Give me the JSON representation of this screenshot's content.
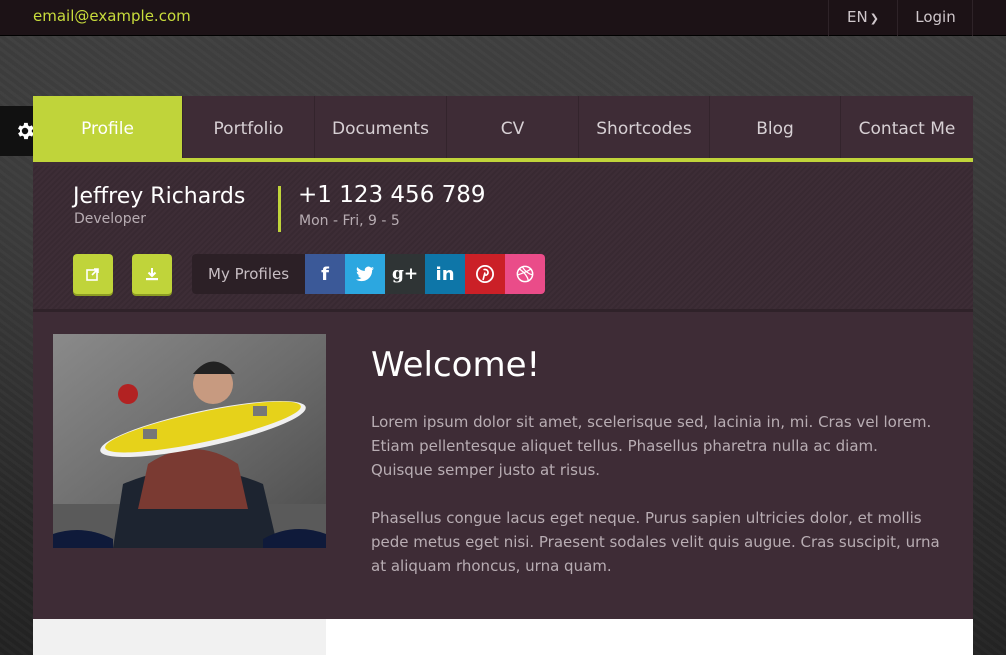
{
  "topbar": {
    "email": "email@example.com",
    "language": "EN",
    "login": "Login"
  },
  "settings": {
    "icon": "gear-icon"
  },
  "nav": {
    "tabs": [
      {
        "label": "Profile",
        "active": true
      },
      {
        "label": "Portfolio",
        "active": false
      },
      {
        "label": "Documents",
        "active": false
      },
      {
        "label": "CV",
        "active": false
      },
      {
        "label": "Shortcodes",
        "active": false
      },
      {
        "label": "Blog",
        "active": false
      },
      {
        "label": "Contact Me",
        "active": false
      }
    ]
  },
  "profile": {
    "name": "Jeffrey Richards",
    "role": "Developer",
    "phone": "+1 123 456 789",
    "hours": "Mon - Fri, 9 - 5"
  },
  "actions": {
    "share_icon": "share-icon",
    "download_icon": "download-icon"
  },
  "profiles": {
    "label": "My Profiles",
    "networks": [
      {
        "name": "facebook",
        "glyph": "f",
        "color": "#3b5998"
      },
      {
        "name": "twitter",
        "glyph": "t",
        "color": "#2ca7e0"
      },
      {
        "name": "google-plus",
        "glyph": "g+",
        "color": "#2f3435"
      },
      {
        "name": "linkedin",
        "glyph": "in",
        "color": "#0e76a8"
      },
      {
        "name": "pinterest",
        "glyph": "p",
        "color": "#cb2027"
      },
      {
        "name": "dribbble",
        "glyph": "◎",
        "color": "#ea4c89"
      }
    ]
  },
  "main": {
    "welcome": "Welcome!",
    "paragraph1": "Lorem ipsum dolor sit amet, scelerisque sed, lacinia in, mi. Cras vel lorem. Etiam pellentesque aliquet tellus. Phasellus pharetra nulla ac diam. Quisque semper justo at risus.",
    "paragraph2": "Phasellus congue lacus eget neque. Purus sapien ultricies dolor, et mollis pede metus eget nisi. Praesent sodales velit quis augue. Cras suscipit, urna at aliquam rhoncus, urna quam."
  },
  "colors": {
    "accent": "#c0d43a",
    "panel": "#3e2c36",
    "topbar": "#1c1216"
  }
}
